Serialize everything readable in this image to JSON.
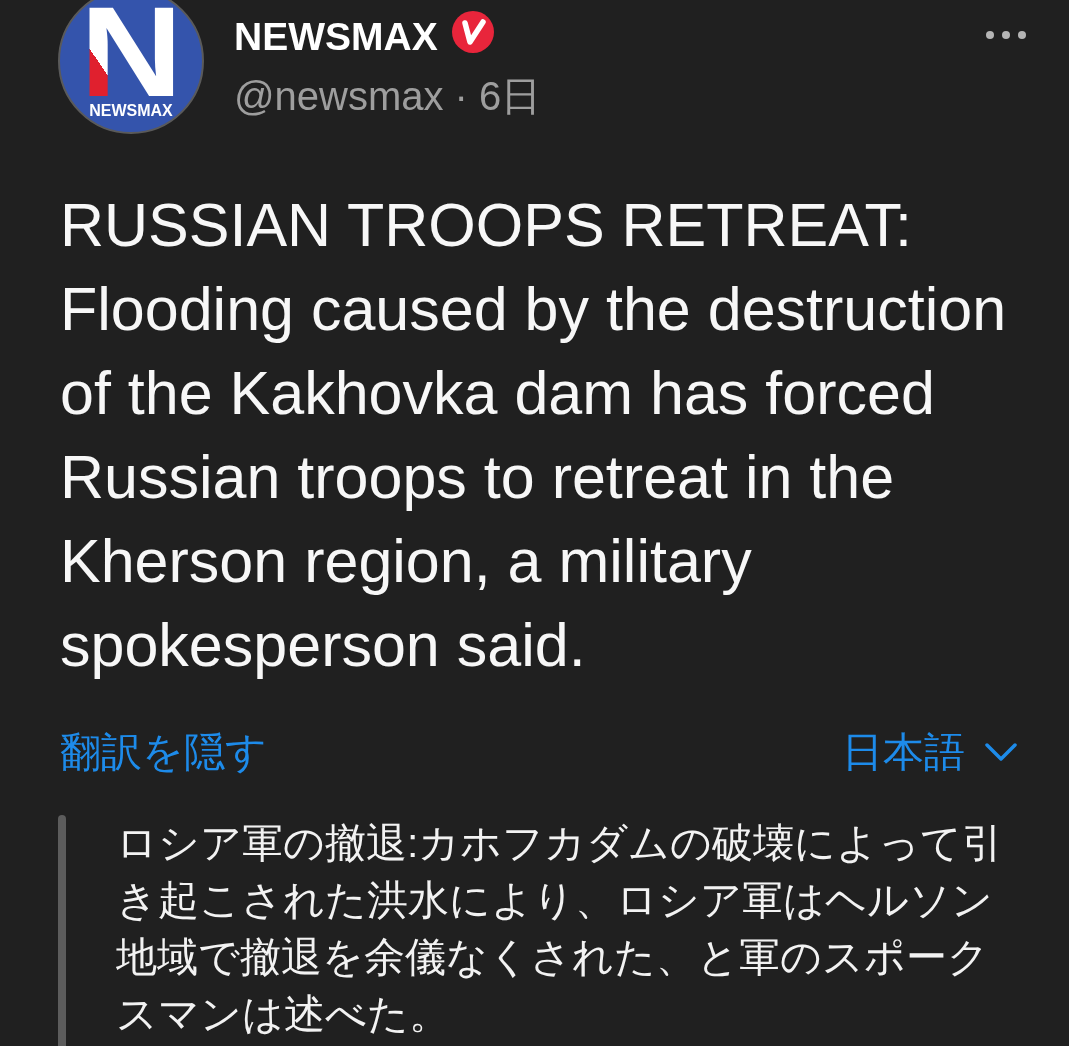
{
  "post": {
    "author": {
      "avatar": {
        "logo_letter": "N",
        "wordmark": "NEWSMAX"
      },
      "name": "NEWSMAX",
      "verified": true,
      "handle": "@newsmax",
      "separator": "·",
      "time": "6日"
    },
    "text": "RUSSIAN TROOPS RETREAT: Flooding caused by the destruction of the Kakhovka dam has forced Russian troops to retreat in the Kherson region, a military spokesperson said."
  },
  "translation": {
    "toggle": "翻訳を隠す",
    "language": "日本語",
    "text": "ロシア軍の撤退:カホフカダムの破壊によって引き起こされた洪水により、ロシア軍はヘルソン地域で撤退を余儀なくされた、と軍のスポークスマンは述べた。"
  }
}
